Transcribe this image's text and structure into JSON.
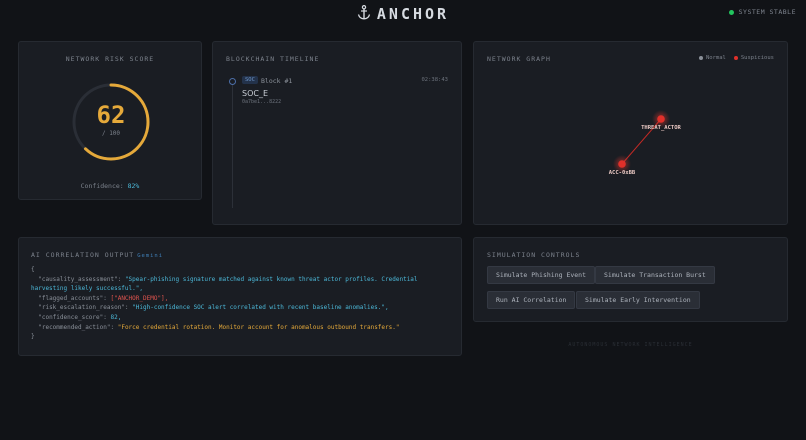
{
  "header": {
    "brand": "ANCHOR",
    "brand_icon": "anchor-icon",
    "status_text": "SYSTEM STABLE",
    "status_color": "#22c55e"
  },
  "risk": {
    "title": "NETWORK RISK SCORE",
    "score": "62",
    "max_label": "/ 100",
    "score_fraction": 0.62,
    "confidence_label": "Confidence:",
    "confidence_value": "82%",
    "accent": "#e5a93a"
  },
  "timeline": {
    "title": "BLOCKCHAIN TIMELINE",
    "entries": [
      {
        "badge": "SOC",
        "block": "Block #1",
        "time": "02:38:43",
        "event": "SOC_E",
        "hash": "0a7be1...8222"
      }
    ]
  },
  "network": {
    "title": "NETWORK GRAPH",
    "legend": [
      {
        "label": "Normal",
        "color": "#8a9099"
      },
      {
        "label": "Suspicious",
        "color": "#e0302a"
      }
    ],
    "nodes": [
      {
        "label": "THREAT_ACTOR",
        "status": "suspicious"
      },
      {
        "label": "ACC-0xBB",
        "status": "suspicious"
      }
    ]
  },
  "ai": {
    "title": "AI CORRELATION OUTPUT",
    "tag": "Gemini",
    "open": "{",
    "close": "}",
    "fields": {
      "causality_key": "\"causality_assessment\": ",
      "causality_val": "\"Spear-phishing signature matched against known threat actor profiles. Credential harvesting likely successful.\",",
      "flagged_key": "\"flagged_accounts\": ",
      "flagged_val": "[\"ANCHOR_DEMO\"],",
      "reason_key": "\"risk_escalation_reason\": ",
      "reason_val": "\"High-confidence SOC alert correlated with recent baseline anomalies.\",",
      "score_key": "\"confidence_score\": ",
      "score_val": "82,",
      "action_key": "\"recommended_action\": ",
      "action_val": "\"Force credential rotation. Monitor account for anomalous outbound transfers.\""
    }
  },
  "simulation": {
    "title": "SIMULATION CONTROLS",
    "buttons": [
      "Simulate Phishing Event",
      "Simulate Transaction Burst",
      "Run AI Correlation",
      "Simulate Early Intervention"
    ]
  },
  "footer": {
    "hint": "AUTONOMOUS NETWORK INTELLIGENCE"
  }
}
